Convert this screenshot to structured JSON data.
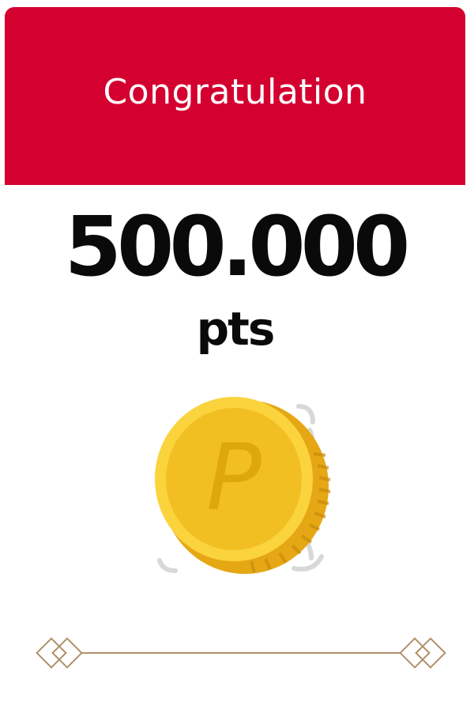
{
  "header": {
    "title": "Congratulation"
  },
  "reward": {
    "amount": "500.000",
    "unit": "pts",
    "coin_symbol": "P"
  },
  "colors": {
    "header_bg": "#d30030",
    "coin_gold": "#f2c12a",
    "divider_gold": "#b08f68"
  },
  "icons": {
    "coin": "coin-icon",
    "divider": "ornament-divider"
  }
}
